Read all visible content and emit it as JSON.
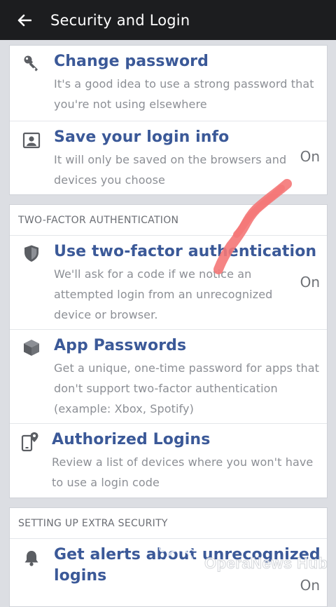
{
  "header": {
    "title": "Security and Login",
    "back_icon": "arrow-left-icon"
  },
  "login_section": {
    "items": [
      {
        "icon": "key-icon",
        "title": "Change password",
        "desc_line1": "It's a good idea to use a strong password that",
        "desc_line2": "you're not using elsewhere",
        "status": ""
      },
      {
        "icon": "id-card-icon",
        "title": "Save your login info",
        "desc_line1": "It will only be saved on the browsers and",
        "desc_line2": "devices you choose",
        "status": "On"
      }
    ]
  },
  "two_factor": {
    "header": "TWO-FACTOR AUTHENTICATION",
    "items": [
      {
        "icon": "shield-icon",
        "title": "Use two-factor authentication",
        "desc_line1": "We'll ask for a code if we notice an",
        "desc_line2": "attempted login from an unrecognized",
        "desc_line3": "device or browser.",
        "status": "On"
      },
      {
        "icon": "cube-icon",
        "title": "App Passwords",
        "desc_line1": "Get a unique, one-time password for apps that",
        "desc_line2": "don't support two-factor authentication",
        "desc_line3": "(example: Xbox, Spotify)",
        "status": ""
      },
      {
        "icon": "phone-location-icon",
        "title": "Authorized Logins",
        "desc_line1": "Review a list of devices where you won't have",
        "desc_line2": "to use a login code",
        "status": ""
      }
    ]
  },
  "extra_security": {
    "header": "SETTING UP EXTRA SECURITY",
    "items": [
      {
        "icon": "bell-icon",
        "title_line1": "Get alerts about unrecognized",
        "title_line2": "logins",
        "status": "On"
      }
    ]
  },
  "overlays": {
    "scribble_color": "#f47777",
    "watermark_text": "OperaNews Hub"
  }
}
